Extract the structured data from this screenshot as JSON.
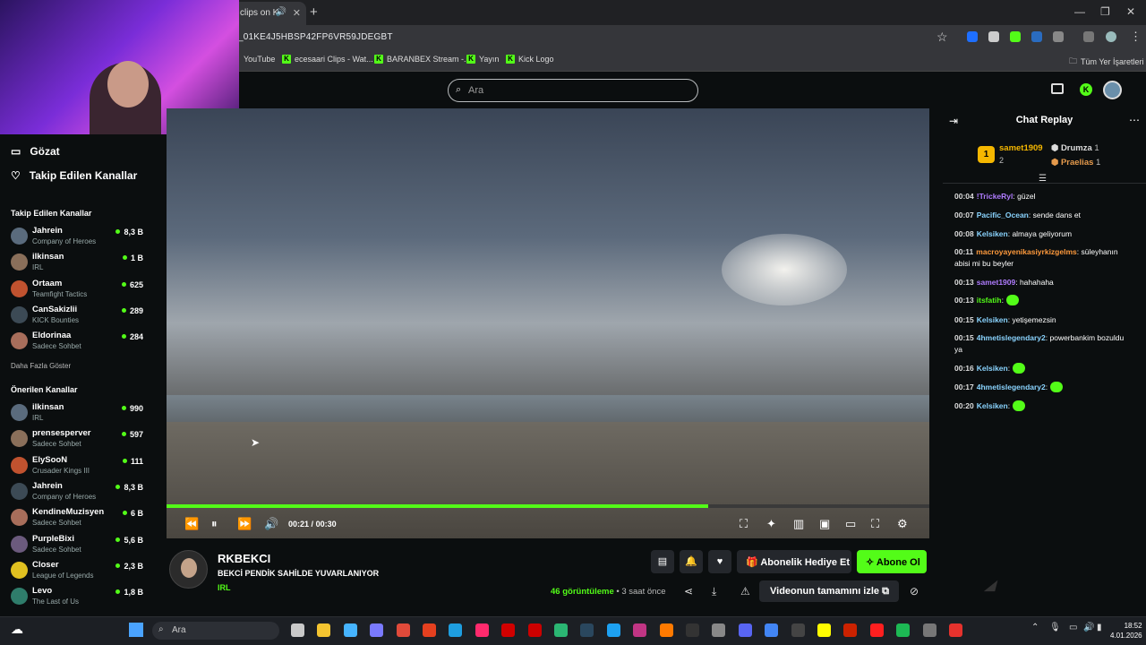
{
  "browser": {
    "tab_title": "clips on K",
    "url": "_01KE4J5HBSP42FP6VR59JDEGBT",
    "bookmarks": [
      "YouTube",
      "ecesaari Clips - Wat...",
      "BARANBEX Stream -...",
      "Yayın",
      "Kick Logo"
    ],
    "all_bookmarks": "Tüm Yer İşaretleri"
  },
  "header": {
    "search_placeholder": "Ara"
  },
  "sidebar": {
    "nav": [
      {
        "label": "Gözat",
        "icon": "compass-icon"
      },
      {
        "label": "Takip Edilen Kanallar",
        "icon": "heart-icon"
      }
    ],
    "following_title": "Takip Edilen Kanallar",
    "following": [
      {
        "name": "Jahrein",
        "game": "Company of Heroes",
        "viewers": "8,3 B"
      },
      {
        "name": "ilkinsan",
        "game": "IRL",
        "viewers": "1 B"
      },
      {
        "name": "Ortaam",
        "game": "Teamfight Tactics",
        "viewers": "625"
      },
      {
        "name": "CanSakizlii",
        "game": "KICK Bounties",
        "viewers": "289"
      },
      {
        "name": "Eldorinaa",
        "game": "Sadece Sohbet",
        "viewers": "284"
      }
    ],
    "show_more": "Daha Fazla Göster",
    "recommended_title": "Önerilen Kanallar",
    "recommended": [
      {
        "name": "ilkinsan",
        "game": "IRL",
        "viewers": "990"
      },
      {
        "name": "prensesperver",
        "game": "Sadece Sohbet",
        "viewers": "597"
      },
      {
        "name": "ElySooN",
        "game": "Crusader Kings III",
        "viewers": "111"
      },
      {
        "name": "Jahrein",
        "game": "Company of Heroes",
        "viewers": "8,3 B"
      },
      {
        "name": "KendineMuzisyen",
        "game": "Sadece Sohbet",
        "viewers": "6 B"
      },
      {
        "name": "PurpleBixi",
        "game": "Sadece Sohbet",
        "viewers": "5,6 B"
      },
      {
        "name": "Closer",
        "game": "League of Legends",
        "viewers": "2,3 B"
      },
      {
        "name": "Levo",
        "game": "The Last of Us",
        "viewers": "1,8 B"
      }
    ]
  },
  "player": {
    "current": "00:21",
    "sep": "/",
    "duration": "00:30",
    "progress": 0.71
  },
  "clip": {
    "channel": "RKBEKCI",
    "title": "BEKCİ PENDİK SAHİLDE YUVARLANIYOR",
    "category": "IRL",
    "gift_label": "Abonelik Hediye Et",
    "subscribe_label": "Abone Ol",
    "views": "46",
    "views_label": "görüntüleme",
    "ago": "• 3 saat önce",
    "full_video_label": "Videonun tamamını izle"
  },
  "chat": {
    "title": "Chat Replay",
    "leaders": {
      "first_name": "samet1909",
      "first_rank": "1",
      "first_count": "2",
      "second": "Drumza",
      "second_count": "1",
      "third": "Praelias",
      "third_count": "1"
    },
    "messages": [
      {
        "time": "00:04",
        "user": "!TrickeRyl",
        "text": ": güzel",
        "color": "#b07cff"
      },
      {
        "time": "00:07",
        "user": "Pacific_Ocean",
        "text": ": sende dans et",
        "color": "#8ad4ff"
      },
      {
        "time": "00:08",
        "user": "Kelsiken",
        "text": ": almaya geliyorum",
        "color": "#8ad4ff"
      },
      {
        "time": "00:11",
        "user": "macroyayenikasiyrkizgelms",
        "text": ": süleyhanın abisi mi bu beyler",
        "color": "#ff9a3c"
      },
      {
        "time": "00:13",
        "user": "samet1909",
        "text": ": hahahaha",
        "color": "#b07cff"
      },
      {
        "time": "00:13",
        "user": "itsfatih",
        "text": ":",
        "color": "#53fc18"
      },
      {
        "time": "00:15",
        "user": "Kelsiken",
        "text": ": yetişemezsin",
        "color": "#8ad4ff"
      },
      {
        "time": "00:15",
        "user": "4hmetislegendary2",
        "text": ": powerbankim bozuldu ya",
        "color": "#8ad4ff"
      },
      {
        "time": "00:16",
        "user": "Kelsiken",
        "text": ":",
        "color": "#8ad4ff"
      },
      {
        "time": "00:17",
        "user": "4hmetislegendary2",
        "text": ":",
        "color": "#8ad4ff"
      },
      {
        "time": "00:20",
        "user": "Kelsiken",
        "text": ":",
        "color": "#8ad4ff"
      }
    ]
  },
  "taskbar": {
    "search": "Ara",
    "time": "18:52",
    "date": "4.01.2026"
  },
  "colors": {
    "accent": "#53fc18"
  }
}
